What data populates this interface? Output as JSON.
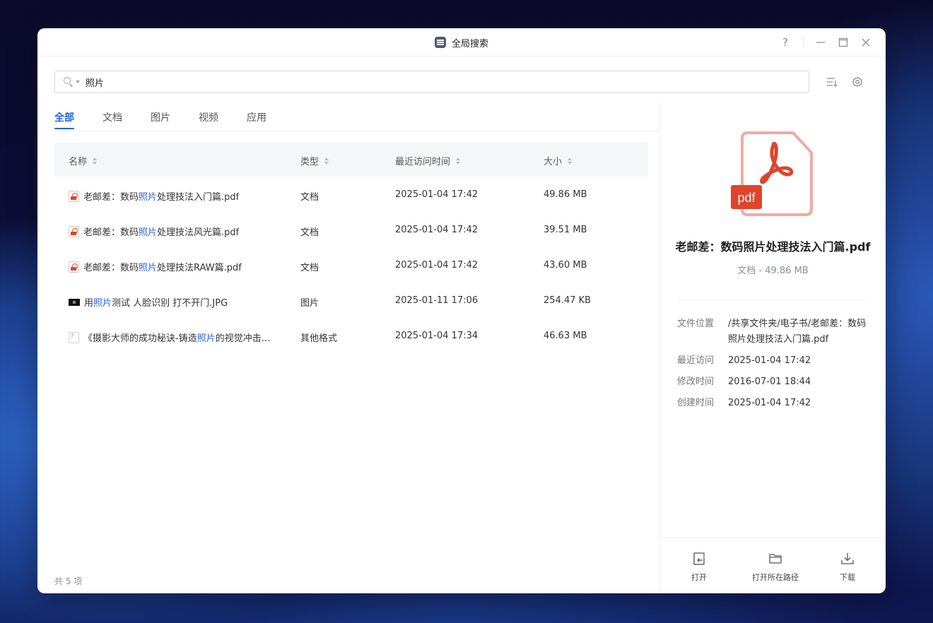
{
  "window": {
    "title": "全局搜索"
  },
  "window_controls": {
    "help": "?"
  },
  "search": {
    "value": "照片"
  },
  "tabs": [
    "全部",
    "文档",
    "图片",
    "视频",
    "应用"
  ],
  "active_tab": "全部",
  "columns": {
    "name": "名称",
    "type": "类型",
    "accessed": "最近访问时间",
    "size": "大小"
  },
  "rows": [
    {
      "pre": "老邮差：数码",
      "hl": "照片",
      "post": "处理技法入门篇.pdf",
      "icon": "pdf-file-icon",
      "type": "文档",
      "accessed": "2025-01-04 17:42",
      "size": "49.86 MB"
    },
    {
      "pre": "老邮差：数码",
      "hl": "照片",
      "post": "处理技法风光篇.pdf",
      "icon": "pdf-file-icon",
      "type": "文档",
      "accessed": "2025-01-04 17:42",
      "size": "39.51 MB"
    },
    {
      "pre": "老邮差：数码",
      "hl": "照片",
      "post": "处理技法RAW篇.pdf",
      "icon": "pdf-file-icon",
      "type": "文档",
      "accessed": "2025-01-04 17:42",
      "size": "43.60 MB"
    },
    {
      "pre": "用",
      "hl": "照片",
      "post": "测试 人脸识别 打不开门.JPG",
      "icon": "image-thumbnail-icon",
      "type": "图片",
      "accessed": "2025-01-11 17:06",
      "size": "254.47 KB"
    },
    {
      "pre": "《摄影大师的成功秘诀-铸造",
      "hl": "照片",
      "post": "的视觉冲击…",
      "icon": "unknown-file-icon",
      "type": "其他格式",
      "accessed": "2025-01-04 17:34",
      "size": "46.63 MB"
    }
  ],
  "footer": {
    "count": "共 5 项"
  },
  "detail": {
    "badge": "pdf",
    "name": "老邮差：数码照片处理技法入门篇.pdf",
    "meta": "文档 - 49.86 MB",
    "fields": [
      {
        "label": "文件位置",
        "value": "/共享文件夹/电子书/老邮差：数码照片处理技法入门篇.pdf"
      },
      {
        "label": "最近访问",
        "value": "2025-01-04 17:42"
      },
      {
        "label": "修改时间",
        "value": "2016-07-01 18:44"
      },
      {
        "label": "创建时间",
        "value": "2025-01-04 17:42"
      }
    ]
  },
  "actions": {
    "open": "打开",
    "open_path": "打开所在路径",
    "download": "下载"
  },
  "colors": {
    "accent": "#2463e0",
    "pdf_red": "#e0442b",
    "pdf_border": "#f2aaa0"
  }
}
